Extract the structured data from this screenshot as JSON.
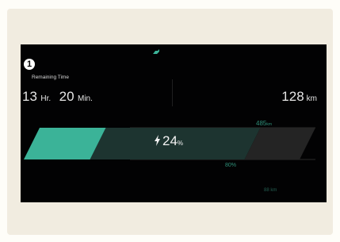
{
  "header": {
    "callout_number": "1",
    "remaining_label": "Remaining Time"
  },
  "time": {
    "hours": "13",
    "hours_unit": "Hr.",
    "minutes": "20",
    "minutes_unit": "Min."
  },
  "range": {
    "value": "128",
    "unit": "km"
  },
  "charge": {
    "level_value": "24",
    "level_unit": "%",
    "level_fraction": 0.24,
    "target_range_value": "485",
    "target_range_unit": "km",
    "target_percent": "80%",
    "target_fraction": 0.8,
    "bottom_label": "88 km"
  },
  "colors": {
    "screen_bg": "#020203",
    "fill": "#3bb398",
    "track": "#1d3430",
    "track_end": "#242424",
    "accent_text": "#2f8f78",
    "page_bg": "#fefdf8",
    "panel_bg": "#f1ece0"
  },
  "icons": {
    "top_indicator": "plug-icon",
    "charge_symbol": "lightning-bolt-icon"
  }
}
